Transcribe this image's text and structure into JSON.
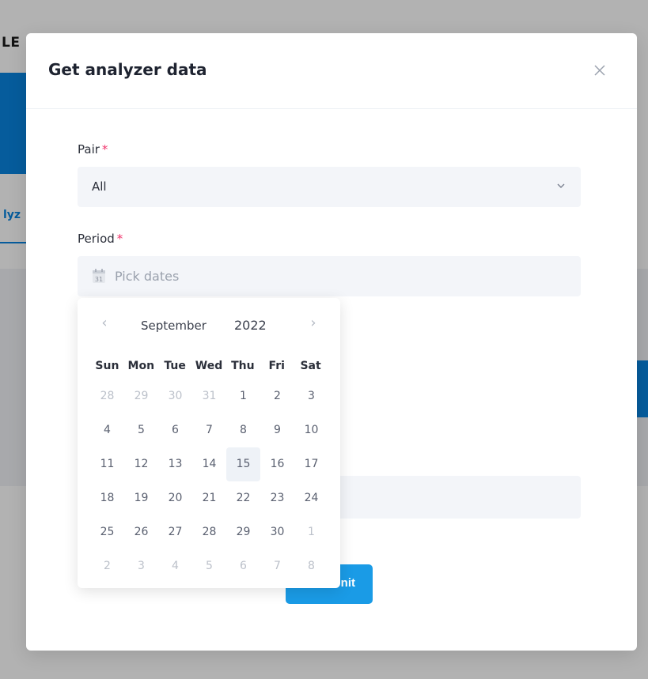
{
  "background": {
    "title_fragment": "LE",
    "tab_fragment": "lyz"
  },
  "modal": {
    "title": "Get analyzer data",
    "close_icon": "close-icon",
    "pair": {
      "label": "Pair",
      "required_mark": "*",
      "value": "All"
    },
    "period": {
      "label": "Period",
      "required_mark": "*",
      "icon_text": "31",
      "placeholder": "Pick dates"
    },
    "submit_visible_text": "nit"
  },
  "calendar": {
    "prev_symbol": "‹",
    "next_symbol": "›",
    "month": "September",
    "year": "2022",
    "weekdays": [
      "Sun",
      "Mon",
      "Tue",
      "Wed",
      "Thu",
      "Fri",
      "Sat"
    ],
    "today": "15",
    "weeks": [
      [
        {
          "d": "28",
          "o": true
        },
        {
          "d": "29",
          "o": true
        },
        {
          "d": "30",
          "o": true
        },
        {
          "d": "31",
          "o": true
        },
        {
          "d": "1",
          "o": false
        },
        {
          "d": "2",
          "o": false
        },
        {
          "d": "3",
          "o": false
        }
      ],
      [
        {
          "d": "4",
          "o": false
        },
        {
          "d": "5",
          "o": false
        },
        {
          "d": "6",
          "o": false
        },
        {
          "d": "7",
          "o": false
        },
        {
          "d": "8",
          "o": false
        },
        {
          "d": "9",
          "o": false
        },
        {
          "d": "10",
          "o": false
        }
      ],
      [
        {
          "d": "11",
          "o": false
        },
        {
          "d": "12",
          "o": false
        },
        {
          "d": "13",
          "o": false
        },
        {
          "d": "14",
          "o": false
        },
        {
          "d": "15",
          "o": false
        },
        {
          "d": "16",
          "o": false
        },
        {
          "d": "17",
          "o": false
        }
      ],
      [
        {
          "d": "18",
          "o": false
        },
        {
          "d": "19",
          "o": false
        },
        {
          "d": "20",
          "o": false
        },
        {
          "d": "21",
          "o": false
        },
        {
          "d": "22",
          "o": false
        },
        {
          "d": "23",
          "o": false
        },
        {
          "d": "24",
          "o": false
        }
      ],
      [
        {
          "d": "25",
          "o": false
        },
        {
          "d": "26",
          "o": false
        },
        {
          "d": "27",
          "o": false
        },
        {
          "d": "28",
          "o": false
        },
        {
          "d": "29",
          "o": false
        },
        {
          "d": "30",
          "o": false
        },
        {
          "d": "1",
          "o": true
        }
      ],
      [
        {
          "d": "2",
          "o": true
        },
        {
          "d": "3",
          "o": true
        },
        {
          "d": "4",
          "o": true
        },
        {
          "d": "5",
          "o": true
        },
        {
          "d": "6",
          "o": true
        },
        {
          "d": "7",
          "o": true
        },
        {
          "d": "8",
          "o": true
        }
      ]
    ]
  },
  "colors": {
    "accent": "#1a9be6",
    "required": "#f0336b",
    "overlay": "rgba(0,0,0,0.30)"
  }
}
